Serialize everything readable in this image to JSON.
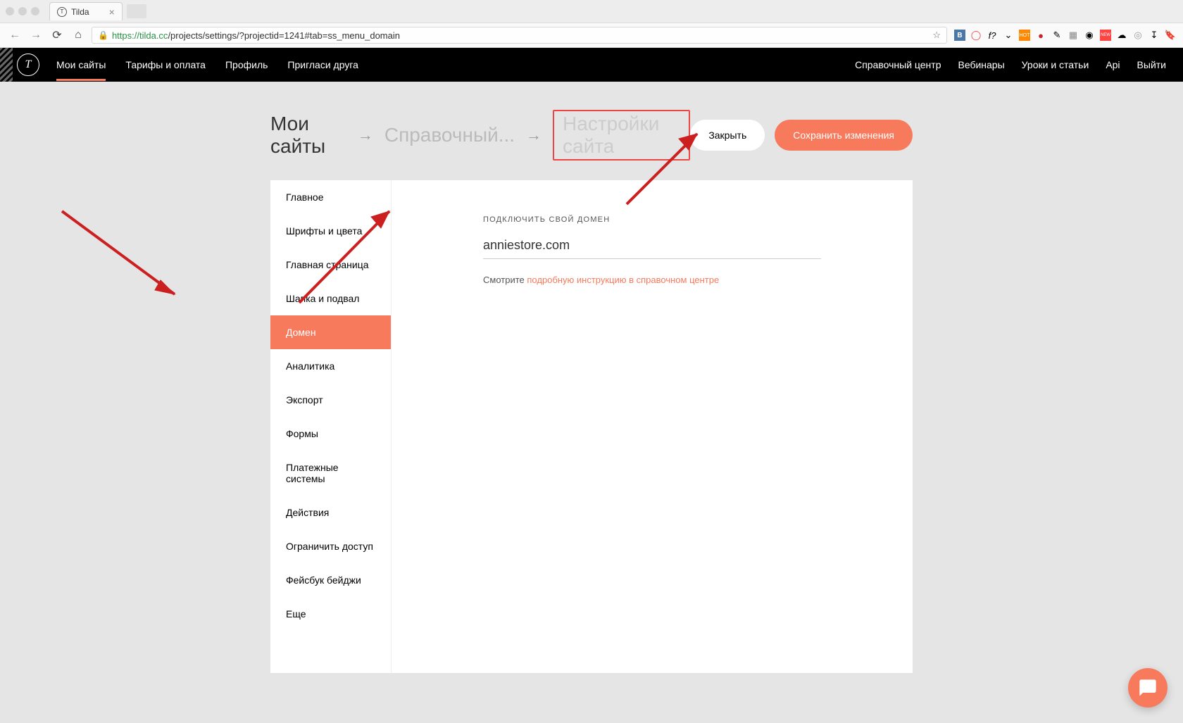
{
  "browser": {
    "tab_title": "Tilda",
    "url_host": "https://tilda.cc",
    "url_path": "/projects/settings/?projectid=1241#tab=ss_menu_domain"
  },
  "header": {
    "nav_left": [
      "Мои сайты",
      "Тарифы и оплата",
      "Профиль",
      "Пригласи друга"
    ],
    "nav_right": [
      "Справочный центр",
      "Вебинары",
      "Уроки и статьи",
      "Api",
      "Выйти"
    ]
  },
  "breadcrumb": {
    "items": [
      "Мои сайты",
      "Справочный...",
      "Настройки сайта"
    ]
  },
  "actions": {
    "close": "Закрыть",
    "save": "Сохранить изменения"
  },
  "sidebar": {
    "items": [
      {
        "label": "Главное"
      },
      {
        "label": "Шрифты и цвета"
      },
      {
        "label": "Главная страница"
      },
      {
        "label": "Шапка и подвал"
      },
      {
        "label": "Домен"
      },
      {
        "label": "Аналитика"
      },
      {
        "label": "Экспорт"
      },
      {
        "label": "Формы"
      },
      {
        "label": "Платежные системы"
      },
      {
        "label": "Действия"
      },
      {
        "label": "Ограничить доступ"
      },
      {
        "label": "Фейсбук бейджи"
      },
      {
        "label": "Еще"
      }
    ],
    "active_index": 4
  },
  "form": {
    "label": "ПОДКЛЮЧИТЬ СВОЙ ДОМЕН",
    "domain_value": "anniestore.com",
    "help_prefix": "Смотрите ",
    "help_link": "подробную инструкцию в справочном центре"
  }
}
